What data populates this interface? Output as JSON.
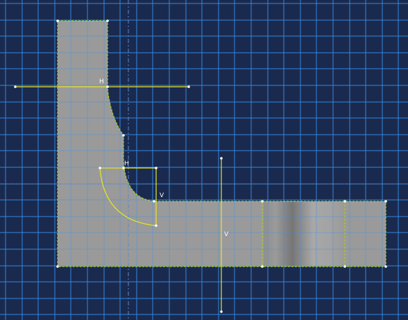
{
  "viewport": {
    "background": "#1a2a4e",
    "grid_color": "#2f7fd8",
    "axis_color": "#5a88c8",
    "part_color": "#9a9a9a",
    "edge_color": "#a8d020",
    "constraint_color": "#e8e820",
    "vertex_color": "#ffffff"
  },
  "constraints": {
    "h_top": "H",
    "h_fillet": "H",
    "v_fillet": "V",
    "v_center": "V"
  }
}
